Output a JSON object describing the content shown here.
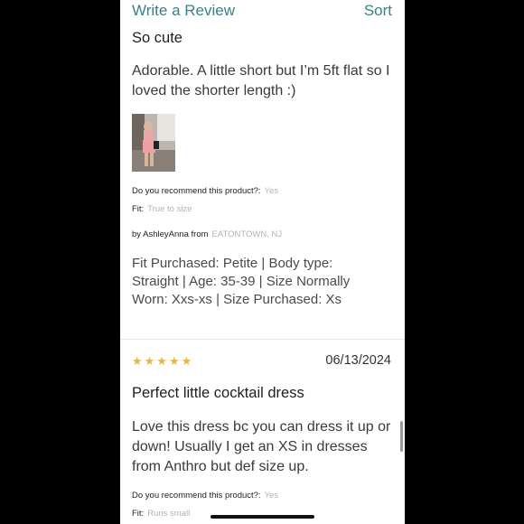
{
  "header": {
    "write_review_label": "Write a Review",
    "sort_label": "Sort"
  },
  "review1": {
    "title": "So cute",
    "body": "Adorable. A little short but I’m 5ft flat so I loved the shorter length :)",
    "recommend_label": "Do you recommend this product?:",
    "recommend_value": "Yes",
    "fit_label": "Fit:",
    "fit_value": "True to size",
    "by_prefix": "by",
    "author": "AshleyAnna",
    "from_label": "from",
    "location": "EATONTOWN, NJ",
    "fit_details": "Fit Purchased: Petite   |   Body type: Straight   |   Age: 35-39   |   Size Normally Worn: Xxs-xs   |   Size Purchased: Xs"
  },
  "review2": {
    "stars": "★★★★★",
    "rating": 5,
    "date": "06/13/2024",
    "title": "Perfect little cocktail dress",
    "body": "Love this dress bc you can dress it up or down! Usually I get an XS in dresses from Anthro but def size up.",
    "recommend_label": "Do you recommend this product?:",
    "recommend_value": "Yes",
    "fit_label": "Fit:",
    "fit_value": "Runs small"
  },
  "colors": {
    "accent": "#3d7f88",
    "star": "#e9b53b",
    "muted": "#b3b3b3"
  }
}
